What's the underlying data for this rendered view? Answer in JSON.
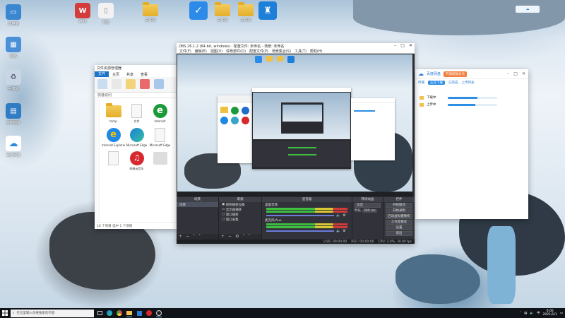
{
  "desktop": {
    "icons": [
      {
        "name": "此电脑"
      },
      {
        "name": "网络"
      },
      {
        "name": "回收站"
      },
      {
        "name": "控制面板"
      },
      {
        "name": "百度网盘"
      },
      {
        "name": "WPS"
      },
      {
        "name": "新建"
      },
      {
        "name": "文件夹"
      },
      {
        "name": "文件夹"
      },
      {
        "name": "文件夹"
      },
      {
        "name": "文件夹"
      }
    ]
  },
  "explorer": {
    "title": "文件资源管理器",
    "tabs": [
      "文件",
      "主页",
      "共享",
      "查看",
      "应用程序工具"
    ],
    "address": "快速访问",
    "items": [
      {
        "name": "temp",
        "icon": "folder-icon"
      },
      {
        "name": "文件",
        "icon": "file-icon"
      },
      {
        "name": "Internet",
        "icon": "ie-icon"
      },
      {
        "name": "",
        "icon": "app-icon"
      },
      {
        "name": "Internet Explorer",
        "icon": "ie-icon"
      },
      {
        "name": "Microsoft Edge",
        "icon": "edge-icon"
      },
      {
        "name": "Microsoft Edge",
        "icon": "file-icon"
      },
      {
        "name": "",
        "icon": "app-icon"
      },
      {
        "name": "",
        "icon": "file-icon"
      },
      {
        "name": "网易云音乐",
        "icon": "music-icon"
      },
      {
        "name": "",
        "icon": "app-icon"
      },
      {
        "name": "",
        "icon": "app-icon"
      }
    ],
    "status": "16 个项目  选中 1 个项目"
  },
  "obs": {
    "title": "OBS 26.1.2 (64-bit, windows) - 配置文件: 未命名 - 场景: 未命名",
    "menu": [
      "文件(F)",
      "编辑(E)",
      "视图(V)",
      "停靠部件(D)",
      "配置文件(P)",
      "场景集合(S)",
      "工具(T)",
      "帮助(H)"
    ],
    "docks": {
      "scenes": {
        "header": "场景",
        "items": [
          "场景"
        ]
      },
      "sources": {
        "header": "来源",
        "items": [
          "视频捕获设备",
          "显示器捕获",
          "窗口捕获",
          "窗口采集"
        ]
      },
      "mixer": {
        "header": "混音器",
        "tracks": [
          "桌面音频",
          "麦克风/Aux"
        ]
      },
      "transitions": {
        "header": "转场动画",
        "type": "淡出",
        "duration_label": "时长",
        "duration": "300 ms"
      },
      "controls": {
        "header": "控件",
        "buttons": [
          "开始推流",
          "开始录制",
          "启动虚拟摄像机",
          "工作室模式",
          "设置",
          "退出"
        ]
      }
    },
    "status_bar": [
      "LIVE: 00:00:00",
      "REC: 00:00:00",
      "CPU: 3.0%, 30.00 fps"
    ]
  },
  "right_window": {
    "title": "百度网盘",
    "badge": "开通超级会员",
    "nav": [
      "传输",
      "正在下载",
      "已完成",
      "上传列表"
    ],
    "rows": [
      {
        "label": "下载中",
        "progress": 0.6
      },
      {
        "label": "上传中",
        "progress": 0.55
      }
    ]
  },
  "taskbar": {
    "search_placeholder": "在这里输入你要搜索的内容",
    "time": "0:00",
    "date": "2021/1/1",
    "tray_lang": "中"
  }
}
